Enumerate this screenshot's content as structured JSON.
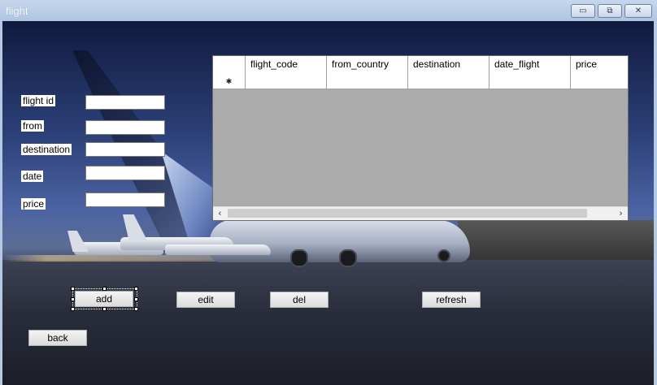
{
  "window": {
    "title": "flight",
    "minimize_glyph": "▭",
    "maximize_glyph": "⧉",
    "close_glyph": "✕"
  },
  "form": {
    "fields": [
      {
        "label": "flight id",
        "value": ""
      },
      {
        "label": "from",
        "value": ""
      },
      {
        "label": "destination",
        "value": ""
      },
      {
        "label": "date",
        "value": ""
      },
      {
        "label": "price",
        "value": ""
      }
    ]
  },
  "grid": {
    "columns": [
      "flight_code",
      "from_country",
      "destination",
      "date_flight",
      "price"
    ],
    "new_row_marker": "✱",
    "scroll_left": "‹",
    "scroll_right": "›"
  },
  "buttons": {
    "add": "add",
    "edit": "edit",
    "del": "del",
    "refresh": "refresh",
    "back": "back"
  },
  "colors": {
    "titlebar": "#aec4e2",
    "grid_background": "#ababab"
  },
  "icons": [
    "minimize-icon",
    "maximize-icon",
    "close-icon",
    "new-row-icon",
    "scroll-left-icon",
    "scroll-right-icon"
  ]
}
